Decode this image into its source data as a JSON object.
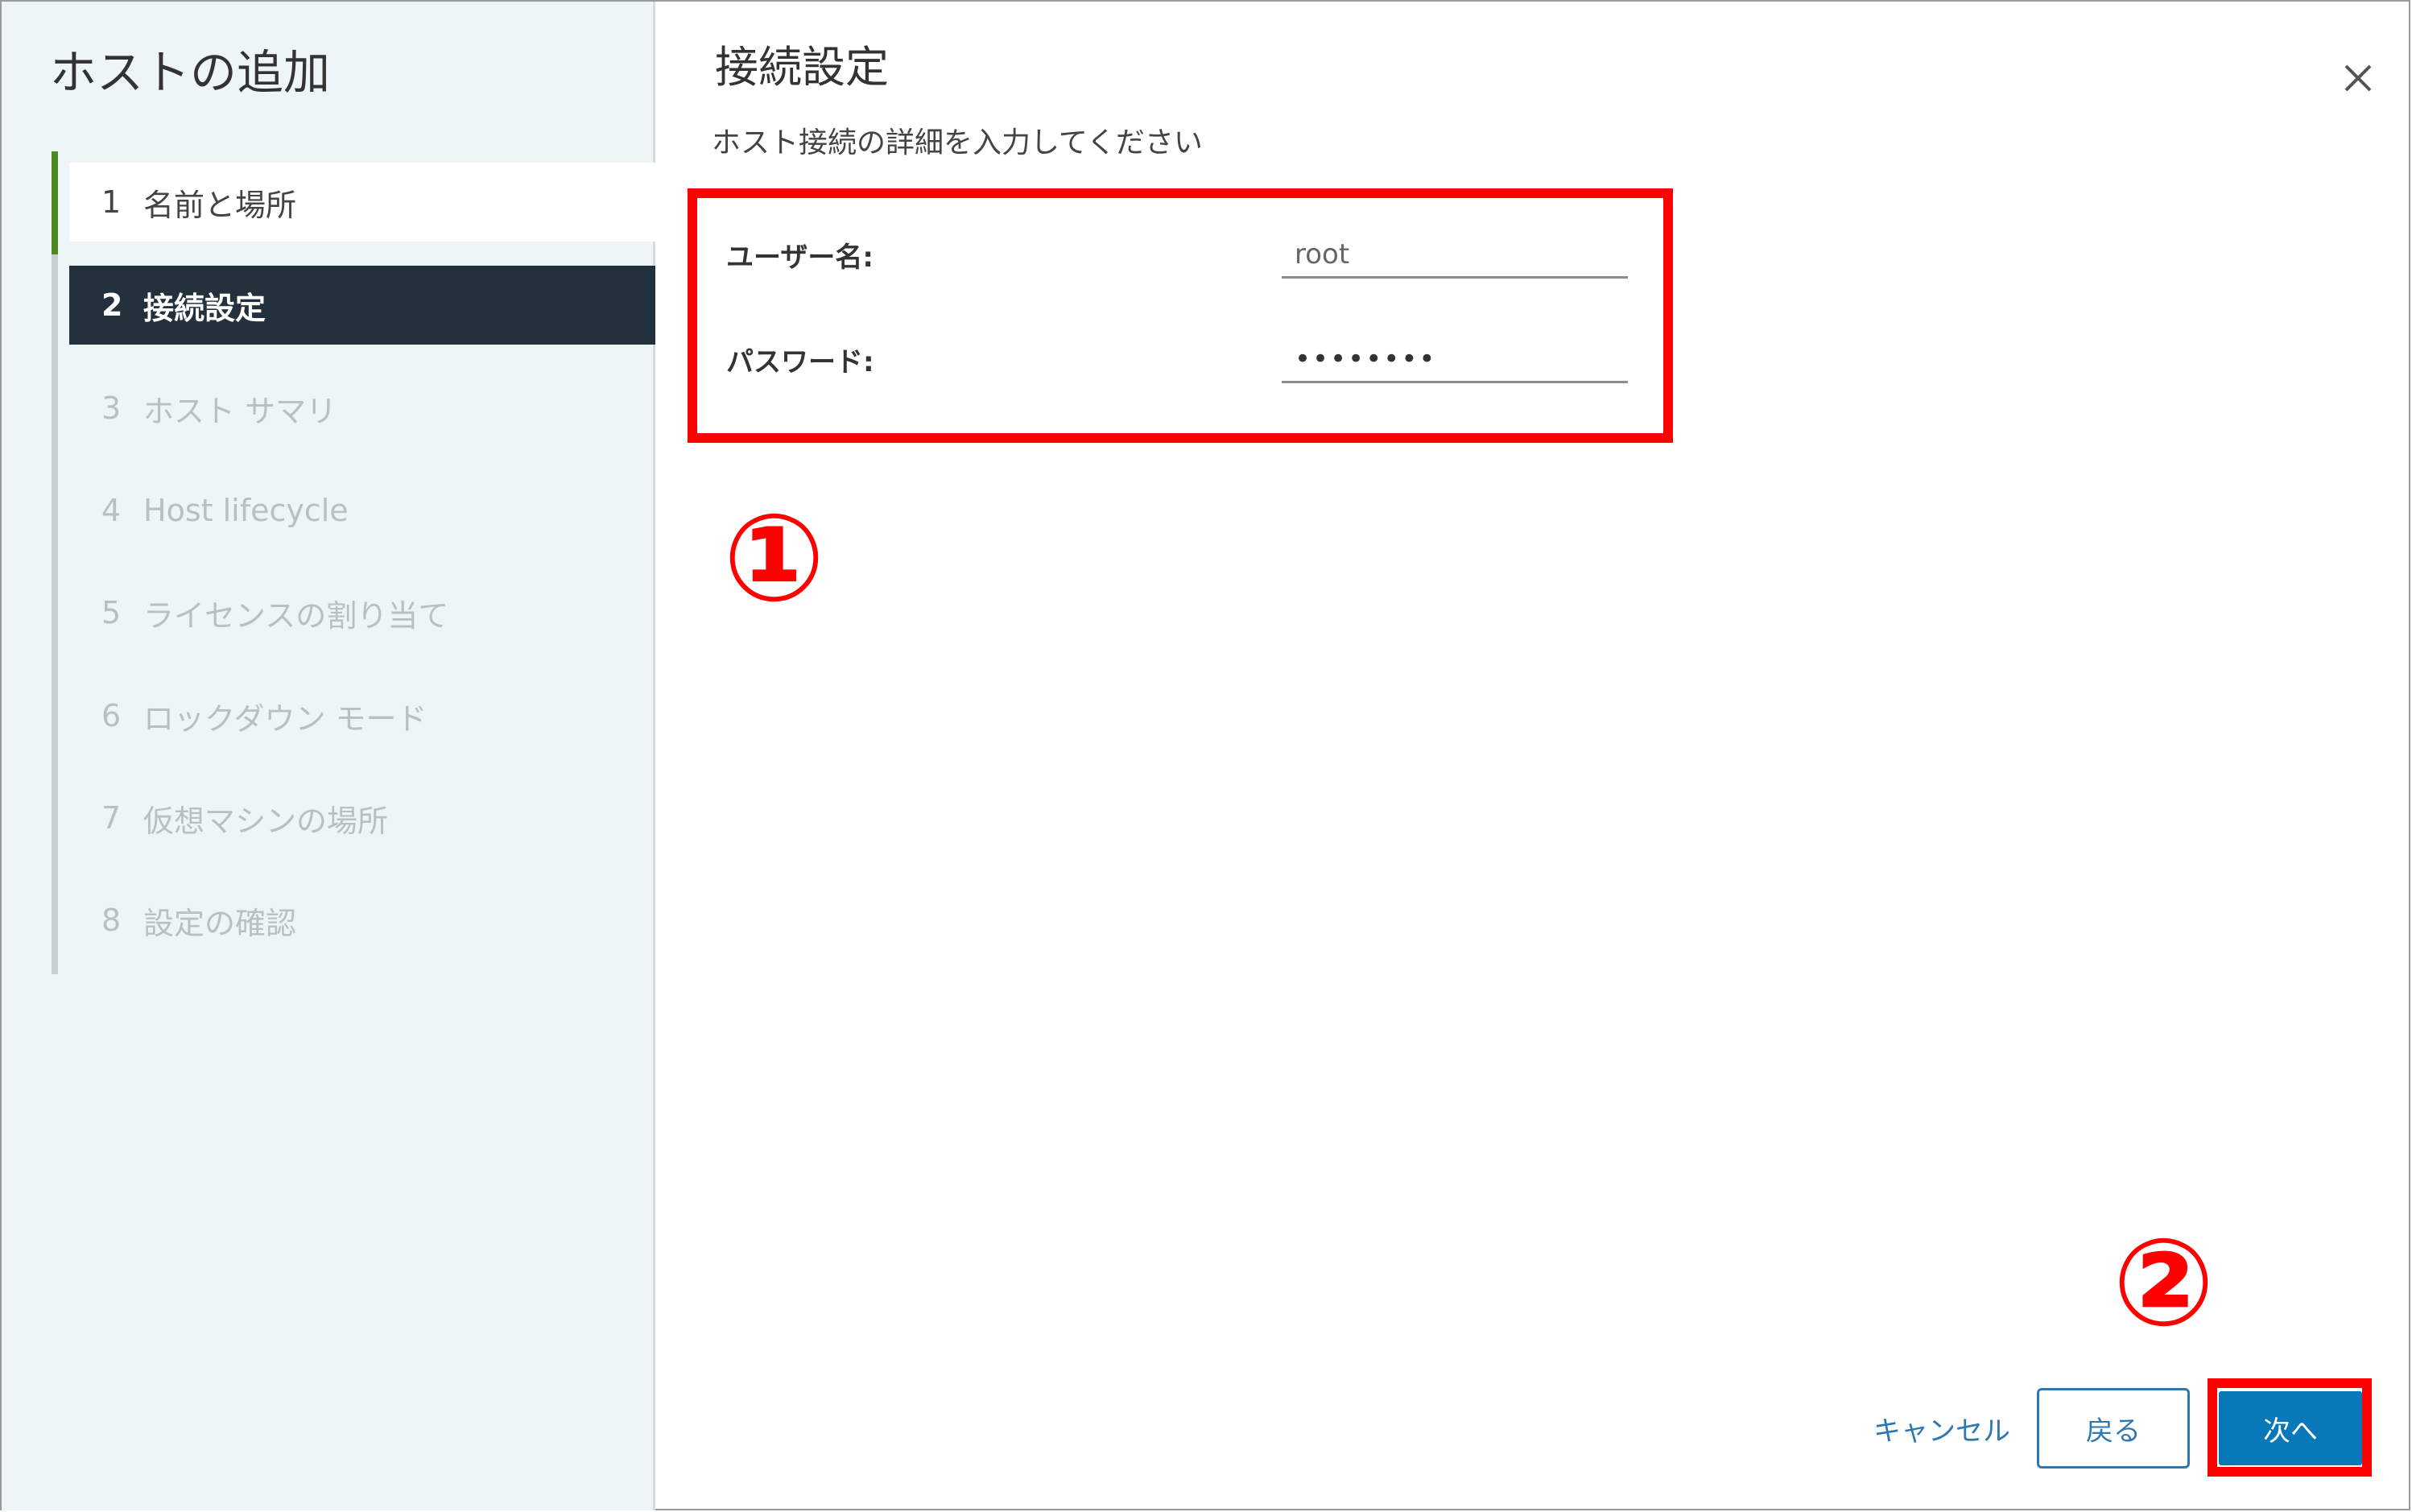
{
  "wizard": {
    "title": "ホストの追加",
    "steps": [
      {
        "num": "1",
        "label": "名前と場所",
        "state": "done"
      },
      {
        "num": "2",
        "label": "接続設定",
        "state": "active"
      },
      {
        "num": "3",
        "label": "ホスト サマリ",
        "state": "todo"
      },
      {
        "num": "4",
        "label": "Host lifecycle",
        "state": "todo"
      },
      {
        "num": "5",
        "label": "ライセンスの割り当て",
        "state": "todo"
      },
      {
        "num": "6",
        "label": "ロックダウン モード",
        "state": "todo"
      },
      {
        "num": "7",
        "label": "仮想マシンの場所",
        "state": "todo"
      },
      {
        "num": "8",
        "label": "設定の確認",
        "state": "todo"
      }
    ]
  },
  "content": {
    "title": "接続設定",
    "subtitle": "ホスト接続の詳細を入力してください",
    "close_icon": "close-icon",
    "username_label": "ユーザー名:",
    "username_value": "root",
    "password_label": "パスワード:",
    "password_value": "••••••••"
  },
  "annotations": {
    "marker_1": "①",
    "marker_2": "②",
    "highlight_color": "#ff0000"
  },
  "footer": {
    "cancel_label": "キャンセル",
    "back_label": "戻る",
    "next_label": "次へ"
  },
  "colors": {
    "active_step_bg": "#22313b",
    "progress_accent": "#4e8a23",
    "primary_button": "#0878b8",
    "link": "#2f77b3"
  }
}
